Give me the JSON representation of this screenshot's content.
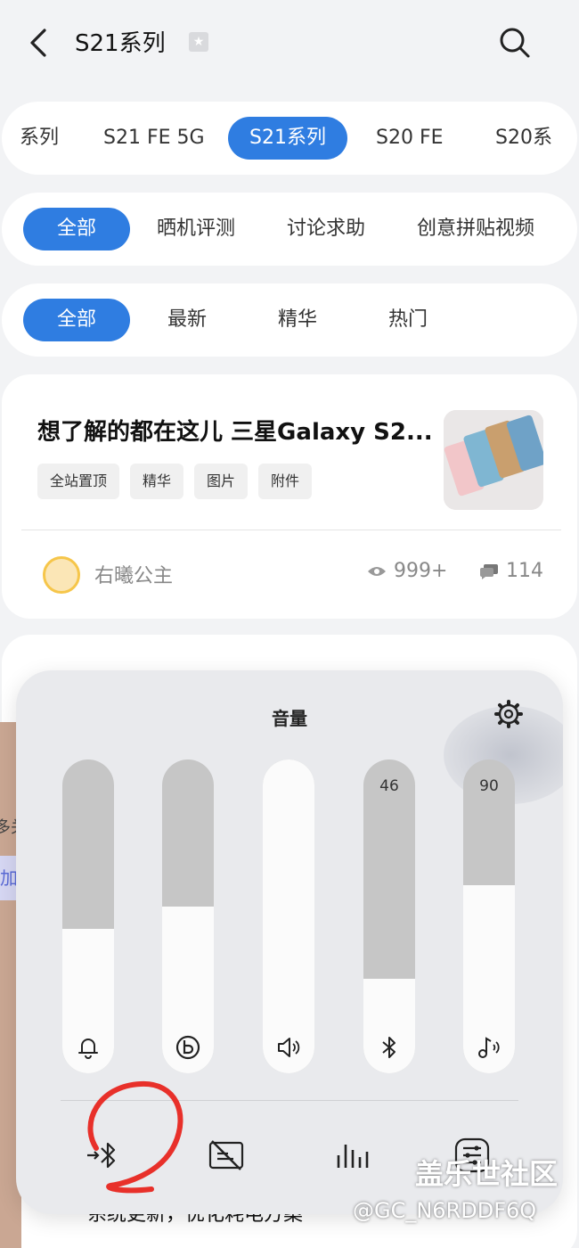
{
  "header": {
    "title": "S21系列",
    "back_icon": "chevron-left-icon",
    "search_icon": "search-icon",
    "favorite_icon": "star-icon"
  },
  "series_tabs": {
    "items": [
      {
        "label": "系列",
        "active": false
      },
      {
        "label": "S21 FE 5G",
        "active": false
      },
      {
        "label": "S21系列",
        "active": true
      },
      {
        "label": "S20 FE",
        "active": false
      },
      {
        "label": "S20系",
        "active": false
      }
    ]
  },
  "category_tabs": {
    "items": [
      {
        "label": "全部",
        "active": true
      },
      {
        "label": "晒机评测",
        "active": false
      },
      {
        "label": "讨论求助",
        "active": false
      },
      {
        "label": "创意拼贴视频",
        "active": false
      }
    ]
  },
  "sort_tabs": {
    "items": [
      {
        "label": "全部",
        "active": true
      },
      {
        "label": "最新",
        "active": false
      },
      {
        "label": "精华",
        "active": false
      },
      {
        "label": "热门",
        "active": false
      }
    ]
  },
  "post": {
    "title": "想了解的都在这儿 三星Galaxy S2...",
    "tags": [
      "全站置顶",
      "精华",
      "图片",
      "附件"
    ],
    "author": "右曦公主",
    "views": "999+",
    "comments": "114"
  },
  "background": {
    "strip_text_1": "多关",
    "strip_text_2": "加",
    "partial_text": "系统更新，优化耗电方案",
    "dots": "•••"
  },
  "volume_panel": {
    "title": "音量",
    "settings_icon": "gear-icon",
    "sliders": [
      {
        "name": "ringtone",
        "icon": "bell-icon",
        "level": 0.46,
        "value_label": ""
      },
      {
        "name": "bixby",
        "icon": "bixby-icon",
        "level": 0.53,
        "value_label": ""
      },
      {
        "name": "media",
        "icon": "speaker-icon",
        "level": 1.0,
        "value_label": ""
      },
      {
        "name": "bluetooth",
        "icon": "bluetooth-icon",
        "level": 0.3,
        "value_label": "46"
      },
      {
        "name": "music",
        "icon": "music-note-icon",
        "level": 0.6,
        "value_label": "90"
      }
    ],
    "bottom_actions": [
      {
        "name": "bluetooth-output",
        "icon": "bluetooth-arrow-icon"
      },
      {
        "name": "caption-off",
        "icon": "caption-off-icon"
      },
      {
        "name": "equalizer",
        "icon": "equalizer-icon"
      },
      {
        "name": "sound-settings",
        "icon": "settings-list-icon"
      }
    ]
  },
  "watermark": {
    "line1": "盖乐世社区",
    "line2": "@GC_N6RDDF6Q"
  },
  "colors": {
    "accent": "#2f7de1",
    "slider_track": "#c6c6c6",
    "slider_fill": "#fbfbfb",
    "annotation": "#e8302a"
  }
}
